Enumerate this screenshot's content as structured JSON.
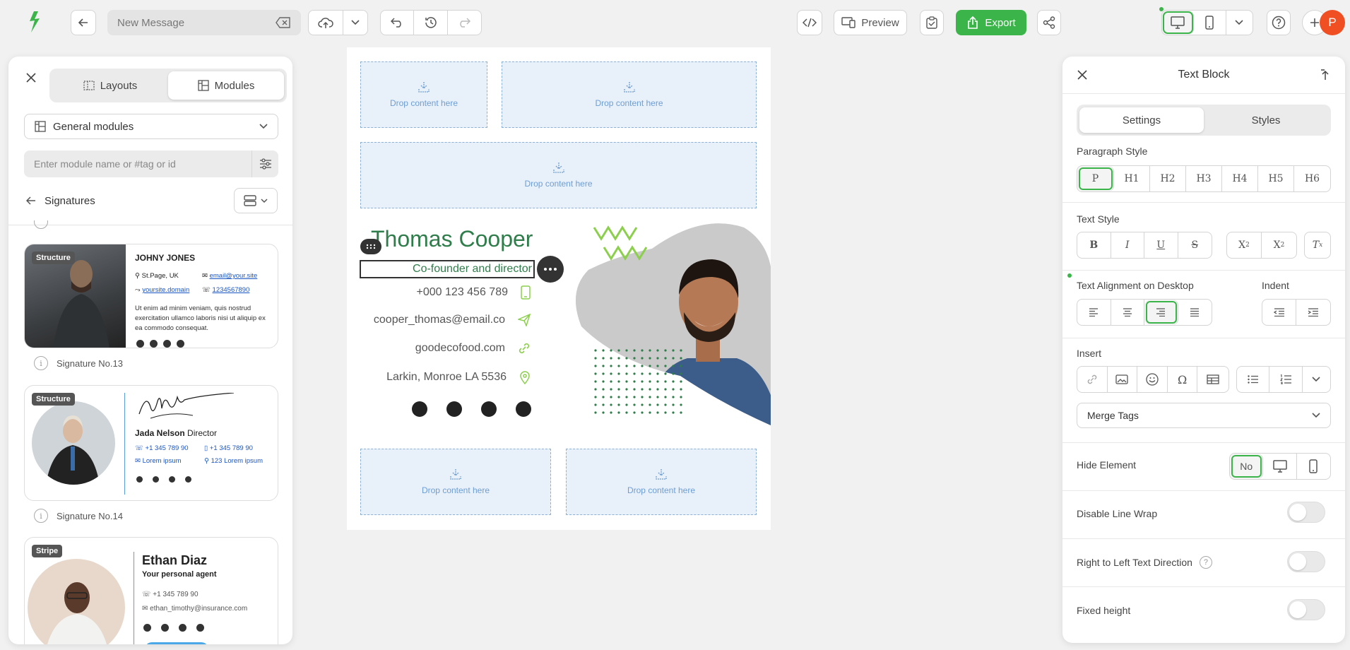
{
  "topbar": {
    "message_placeholder": "New Message",
    "preview_label": "Preview",
    "export_label": "Export",
    "avatar_letter": "P"
  },
  "left_panel": {
    "tabs": [
      {
        "label": "Layouts"
      },
      {
        "label": "Modules"
      }
    ],
    "category": "General modules",
    "search_placeholder": "Enter module name or #tag or id",
    "section_title": "Signatures",
    "cards": [
      {
        "tag": "Structure",
        "name": "JOHNY JONES",
        "location": "St.Page, UK",
        "email": "email@your.site",
        "domain": "yoursite.domain",
        "phone": "1234567890",
        "body": "Ut enim ad minim veniam, quis nostrud exercitation ullamco laboris nisi ut aliquip ex ea commodo consequat.",
        "caption": "Signature No.13"
      },
      {
        "tag": "Structure",
        "name": "Jada Nelson",
        "role": "Director",
        "phone1": "+1 345 789 90",
        "phone2": "+1 345 789 90",
        "text1": "Lorem ipsum",
        "text2": "123 Lorem ipsum",
        "caption": "Signature No.14"
      },
      {
        "tag": "Stripe",
        "name": "Ethan Diaz",
        "role": "Your personal agent",
        "phone": "+1 345 789 90",
        "email": "ethan_timothy@insurance.com"
      }
    ]
  },
  "canvas": {
    "drop_label": "Drop content here",
    "signature": {
      "name": "Thomas Cooper",
      "title": "Co-founder and director",
      "phone": "+000 123 456 789",
      "email": "cooper_thomas@email.co",
      "website": "goodecofood.com",
      "address": "Larkin, Monroe LA 5536"
    },
    "colors": {
      "name": "#2f7d4a",
      "accent": "#8ccf4d",
      "icon": "#8ccf4d"
    }
  },
  "right_panel": {
    "title": "Text Block",
    "tabs": [
      {
        "label": "Settings"
      },
      {
        "label": "Styles"
      }
    ],
    "paragraph_style_label": "Paragraph Style",
    "paragraph_styles": [
      "P",
      "H1",
      "H2",
      "H3",
      "H4",
      "H5",
      "H6"
    ],
    "text_style_label": "Text Style",
    "text_align_label": "Text Alignment on Desktop",
    "indent_label": "Indent",
    "insert_label": "Insert",
    "merge_tags": "Merge Tags",
    "hide_element_label": "Hide Element",
    "hide_no": "No",
    "disable_wrap_label": "Disable Line Wrap",
    "rtl_label": "Right to Left Text Direction",
    "fixed_height_label": "Fixed height"
  },
  "colors": {
    "brand_green": "#3bb54a",
    "selected_outline": "#3bb54a",
    "avatar": "#f04e23"
  }
}
